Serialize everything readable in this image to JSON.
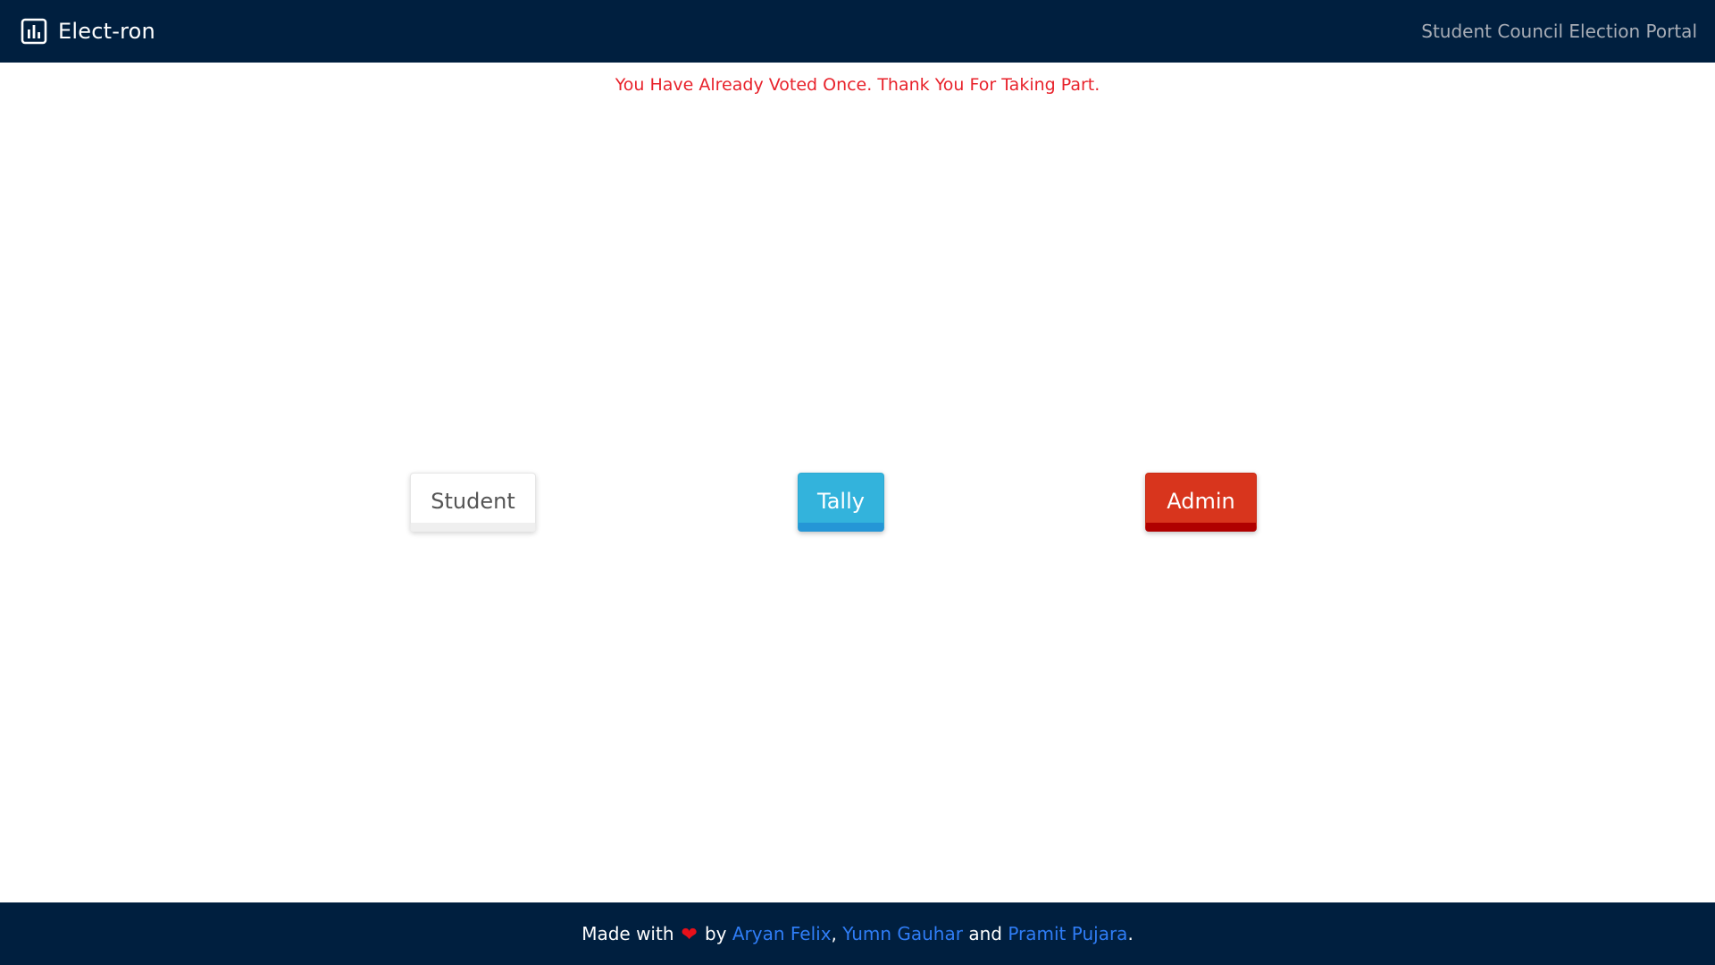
{
  "header": {
    "brand_label": "Elect-ron",
    "brand_icon": "bar-chart-icon",
    "portal_title": "Student Council Election Portal"
  },
  "alert": {
    "message": "You Have Already Voted Once. Thank You For Taking Part."
  },
  "buttons": {
    "student_label": "Student",
    "tally_label": "Tally",
    "admin_label": "Admin"
  },
  "footer": {
    "made_with": "Made with",
    "heart_icon": "heart-icon",
    "by": "by",
    "author1": "Aryan Felix",
    "comma": ",",
    "author2": "Yumn Gauhar",
    "and": "and",
    "author3": "Pramit Pujara",
    "period": "."
  },
  "colors": {
    "navbar_bg": "#001f3f",
    "alert_text": "#e8222b",
    "tally": "#33b3dc",
    "admin": "#d8351d",
    "link": "#2f7df6"
  }
}
